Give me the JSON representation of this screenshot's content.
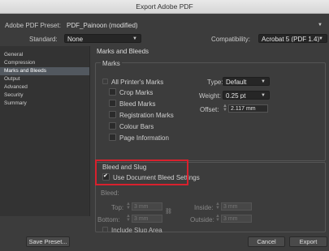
{
  "window": {
    "title": "Export Adobe PDF"
  },
  "header": {
    "preset_label": "Adobe PDF Preset:",
    "preset_value": "PDF_Painoon (modified)",
    "standard_label": "Standard:",
    "standard_value": "None",
    "compat_label": "Compatibility:",
    "compat_value": "Acrobat 5 (PDF 1.4)"
  },
  "sidebar": {
    "items": [
      {
        "label": "General"
      },
      {
        "label": "Compression"
      },
      {
        "label": "Marks and Bleeds"
      },
      {
        "label": "Output"
      },
      {
        "label": "Advanced"
      },
      {
        "label": "Security"
      },
      {
        "label": "Summary"
      }
    ],
    "active_index": 2
  },
  "pane": {
    "title": "Marks and Bleeds",
    "marks": {
      "legend": "Marks",
      "all_printers": "All Printer's Marks",
      "crop": "Crop Marks",
      "bleed": "Bleed Marks",
      "registration": "Registration Marks",
      "colour": "Colour Bars",
      "page_info": "Page Information",
      "type_label": "Type:",
      "type_value": "Default",
      "weight_label": "Weight:",
      "weight_value": "0.25 pt",
      "offset_label": "Offset:",
      "offset_value": "2.117 mm"
    },
    "bleed": {
      "legend": "Bleed and Slug",
      "use_doc": "Use Document Bleed Settings",
      "use_doc_checked": true,
      "bleed_label": "Bleed:",
      "top_label": "Top:",
      "top_value": "3 mm",
      "bottom_label": "Bottom:",
      "bottom_value": "3 mm",
      "inside_label": "Inside:",
      "inside_value": "3 mm",
      "outside_label": "Outside:",
      "outside_value": "3 mm",
      "include_slug": "Include Slug Area"
    }
  },
  "footer": {
    "save_preset": "Save Preset...",
    "cancel": "Cancel",
    "export": "Export"
  },
  "colors": {
    "highlight": "#d8212d",
    "dialog_bg": "#3c3c3c",
    "sidebar_active": "#52585f"
  }
}
